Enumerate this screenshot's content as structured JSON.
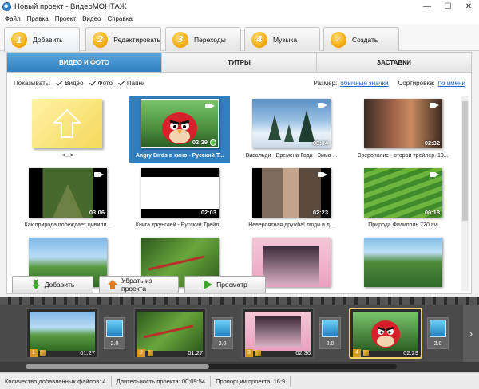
{
  "window": {
    "title": "Новый проект - ВидеоМОНТАЖ"
  },
  "menu": [
    "Файл",
    "Правка",
    "Проект",
    "Видео",
    "Справка"
  ],
  "steps": [
    {
      "num": "1",
      "label": "Добавить"
    },
    {
      "num": "2",
      "label": "Редактировать"
    },
    {
      "num": "3",
      "label": "Переходы"
    },
    {
      "num": "4",
      "label": "Музыка"
    },
    {
      "num": "✓",
      "label": "Создать"
    }
  ],
  "subtabs": [
    "ВИДЕО И ФОТО",
    "ТИТРЫ",
    "ЗАСТАВКИ"
  ],
  "filters": {
    "show_label": "Показывать:",
    "video": "Видео",
    "photo": "Фото",
    "folders": "Папки",
    "size_label": "Размер:",
    "size_value": "обычные значки",
    "sort_label": "Сортировка:",
    "sort_value": "по имени"
  },
  "files": [
    {
      "name": "<...>",
      "duration": ""
    },
    {
      "name": "Angry Birds в кино - Русский Т...",
      "duration": "02:29"
    },
    {
      "name": "Вивальди - Времена Года - Зима ...",
      "duration": "03:34"
    },
    {
      "name": "Зверополис - второй трейлер. 10...",
      "duration": "02:32"
    },
    {
      "name": "Как природа побеждает цивили...",
      "duration": "03:06"
    },
    {
      "name": "Книга джунглей - Русский Трейл...",
      "duration": "02:03"
    },
    {
      "name": "Невероятная дружба! люди и д...",
      "duration": "02:23"
    },
    {
      "name": "Природа Филиппин.720.avi",
      "duration": "00:18"
    },
    {
      "name": "",
      "duration": ""
    },
    {
      "name": "",
      "duration": ""
    },
    {
      "name": "",
      "duration": ""
    },
    {
      "name": "",
      "duration": ""
    }
  ],
  "actions": {
    "add": "Добавить",
    "remove": "Убрать из проекта",
    "preview": "Просмотр"
  },
  "clips": [
    {
      "num": "1",
      "duration": "01:27"
    },
    {
      "num": "2",
      "duration": "01:27"
    },
    {
      "num": "3",
      "duration": "02:36"
    },
    {
      "num": "4",
      "duration": "02:29"
    }
  ],
  "transitions": [
    "2.0",
    "2.0",
    "2.0",
    "2.0"
  ],
  "status": {
    "files_count": "Количество добавленных файлов: 4",
    "duration": "Длительность проекта:  00:09:54",
    "ratio": "Пропорции проекта:  16:9"
  }
}
